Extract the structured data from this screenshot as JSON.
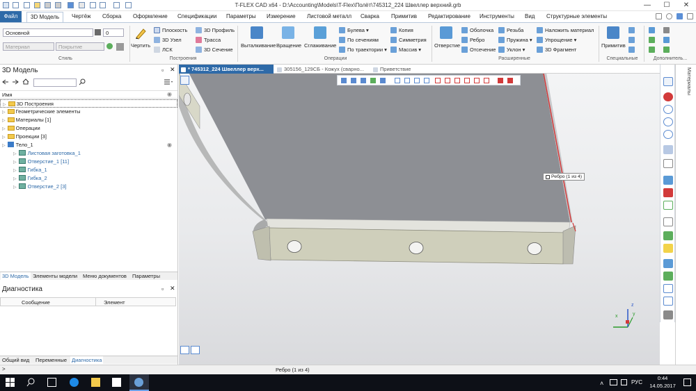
{
  "window": {
    "title": "T-FLEX CAD x64 - D:\\Accounting\\Models\\T-Flex\\Полёт\\745312_224 Швеллер верхний.grb",
    "minimize": "—",
    "maximize": "☐",
    "close": "✕"
  },
  "menu": {
    "file": "Файл",
    "items": [
      "3D Модель",
      "Чертёж",
      "Сборка",
      "Оформление",
      "Спецификации",
      "Параметры",
      "Измерение",
      "Листовой металл",
      "Сварка",
      "Примитив",
      "Редактирование",
      "Инструменты",
      "Вид",
      "Структурные элементы"
    ]
  },
  "ribbon": {
    "style": {
      "layer": "Основной",
      "width_value": "0",
      "material_placeholder": "Материал",
      "coating_placeholder": "Покрытие",
      "group": "Стиль"
    },
    "construction": {
      "draw": "Чертить",
      "plane": "Плоскость",
      "node3d": "3D Узел",
      "lsk": "ЛСК",
      "profile3d": "3D Профиль",
      "path": "Трасса",
      "section3d": "3D Сечение",
      "group": "Построения"
    },
    "operations": {
      "extrude": "Выталкивание",
      "rotate": "Вращение",
      "smooth": "Сглаживание",
      "boolean": "Булева",
      "by_sections": "По сечениям",
      "by_path": "По траектории",
      "copy": "Копия",
      "symmetry": "Симметрия",
      "array": "Массив",
      "group": "Операции"
    },
    "extended": {
      "hole": "Отверстие",
      "shell": "Оболочка",
      "rib": "Ребро",
      "cut": "Отсечение",
      "thread": "Резьба",
      "spring": "Пружина",
      "slope": "Уклон",
      "apply_material": "Наложить материал",
      "simplify": "Упрощение",
      "fragment3d": "3D Фрагмент",
      "group": "Расширенные"
    },
    "special": {
      "primitive": "Примитив",
      "group": "Специальные"
    },
    "additional": {
      "group": "Дополнитель..."
    }
  },
  "left_panel": {
    "title": "3D Модель",
    "pin": "▫",
    "close": "✕",
    "column": "Имя",
    "tree": [
      {
        "label": "3D Построения",
        "level": 0,
        "kind": "folder"
      },
      {
        "label": "Геометрические элементы",
        "level": 0,
        "kind": "folder"
      },
      {
        "label": "Материалы [1]",
        "level": 0,
        "kind": "folder"
      },
      {
        "label": "Операции",
        "level": 0,
        "kind": "folder"
      },
      {
        "label": "Проекции [3]",
        "level": 0,
        "kind": "folder"
      },
      {
        "label": "Тело_1",
        "level": 0,
        "kind": "body"
      },
      {
        "label": "Листовая заготовка_1",
        "level": 1,
        "kind": "feature"
      },
      {
        "label": "Отверстие_1 [11]",
        "level": 1,
        "kind": "feature"
      },
      {
        "label": "Гибка_1",
        "level": 1,
        "kind": "feature"
      },
      {
        "label": "Гибка_2",
        "level": 1,
        "kind": "feature"
      },
      {
        "label": "Отверстие_2 [3]",
        "level": 1,
        "kind": "feature"
      }
    ],
    "tabs": [
      "3D Модель",
      "Элементы модели",
      "Меню документов",
      "Параметры"
    ]
  },
  "diagnostics": {
    "title": "Диагностика",
    "col_message": "Сообщение",
    "col_element": "Элемент",
    "tabs": [
      "Общий вид",
      "Переменные",
      "Диагностика"
    ]
  },
  "doc_tabs": [
    {
      "label": "* 745312_224 Швеллер верх...",
      "active": true
    },
    {
      "label": "305156_129СБ - Кожух (сварно...",
      "active": false
    },
    {
      "label": "Приветствие",
      "active": false
    }
  ],
  "viewport": {
    "tooltip": "Ребро (1 из 4)",
    "axis_x": "x",
    "axis_y": "y",
    "axis_z": "z"
  },
  "right_panel": {
    "label": "Материалы"
  },
  "status": {
    "text": "Ребро (1 из 4)",
    "prompt": ">"
  },
  "taskbar": {
    "lang": "РУС",
    "time": "0:44",
    "date": "14.05.2017"
  },
  "colors": {
    "accent": "#2e6aa8",
    "part_top": "#8c8e92",
    "part_flange": "#cfcfbb",
    "edge_highlight": "#d23a3a",
    "taskbar": "#0d1017"
  }
}
